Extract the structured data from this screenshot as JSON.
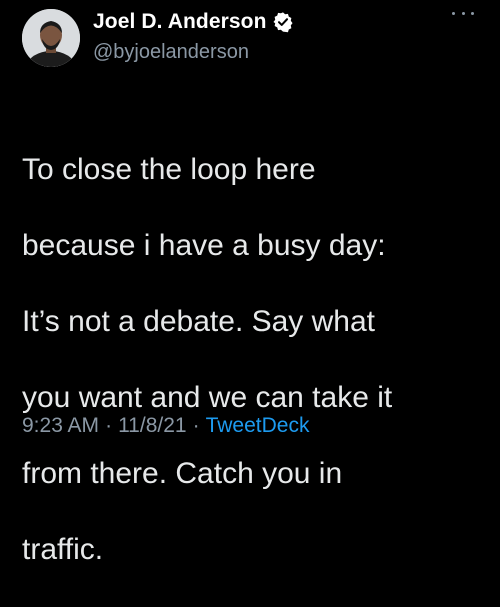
{
  "author": {
    "display_name": "Joel D. Anderson",
    "handle": "@byjoelanderson",
    "verified_icon": "verified-badge-icon",
    "avatar": "profile-photo"
  },
  "menu": {
    "icon": "more-options-icon"
  },
  "tweet": {
    "lines": [
      "To close the loop here",
      "because i have a busy day:",
      "It’s not a debate. Say what",
      "you want and we can take it",
      "from there. Catch you in",
      "traffic."
    ]
  },
  "meta": {
    "time": "9:23 AM",
    "separator": "·",
    "date": "11/8/21",
    "source": "TweetDeck"
  },
  "colors": {
    "background": "#000000",
    "text": "#e7e9ea",
    "secondary": "#8b98a5",
    "link": "#1d9bf0"
  }
}
